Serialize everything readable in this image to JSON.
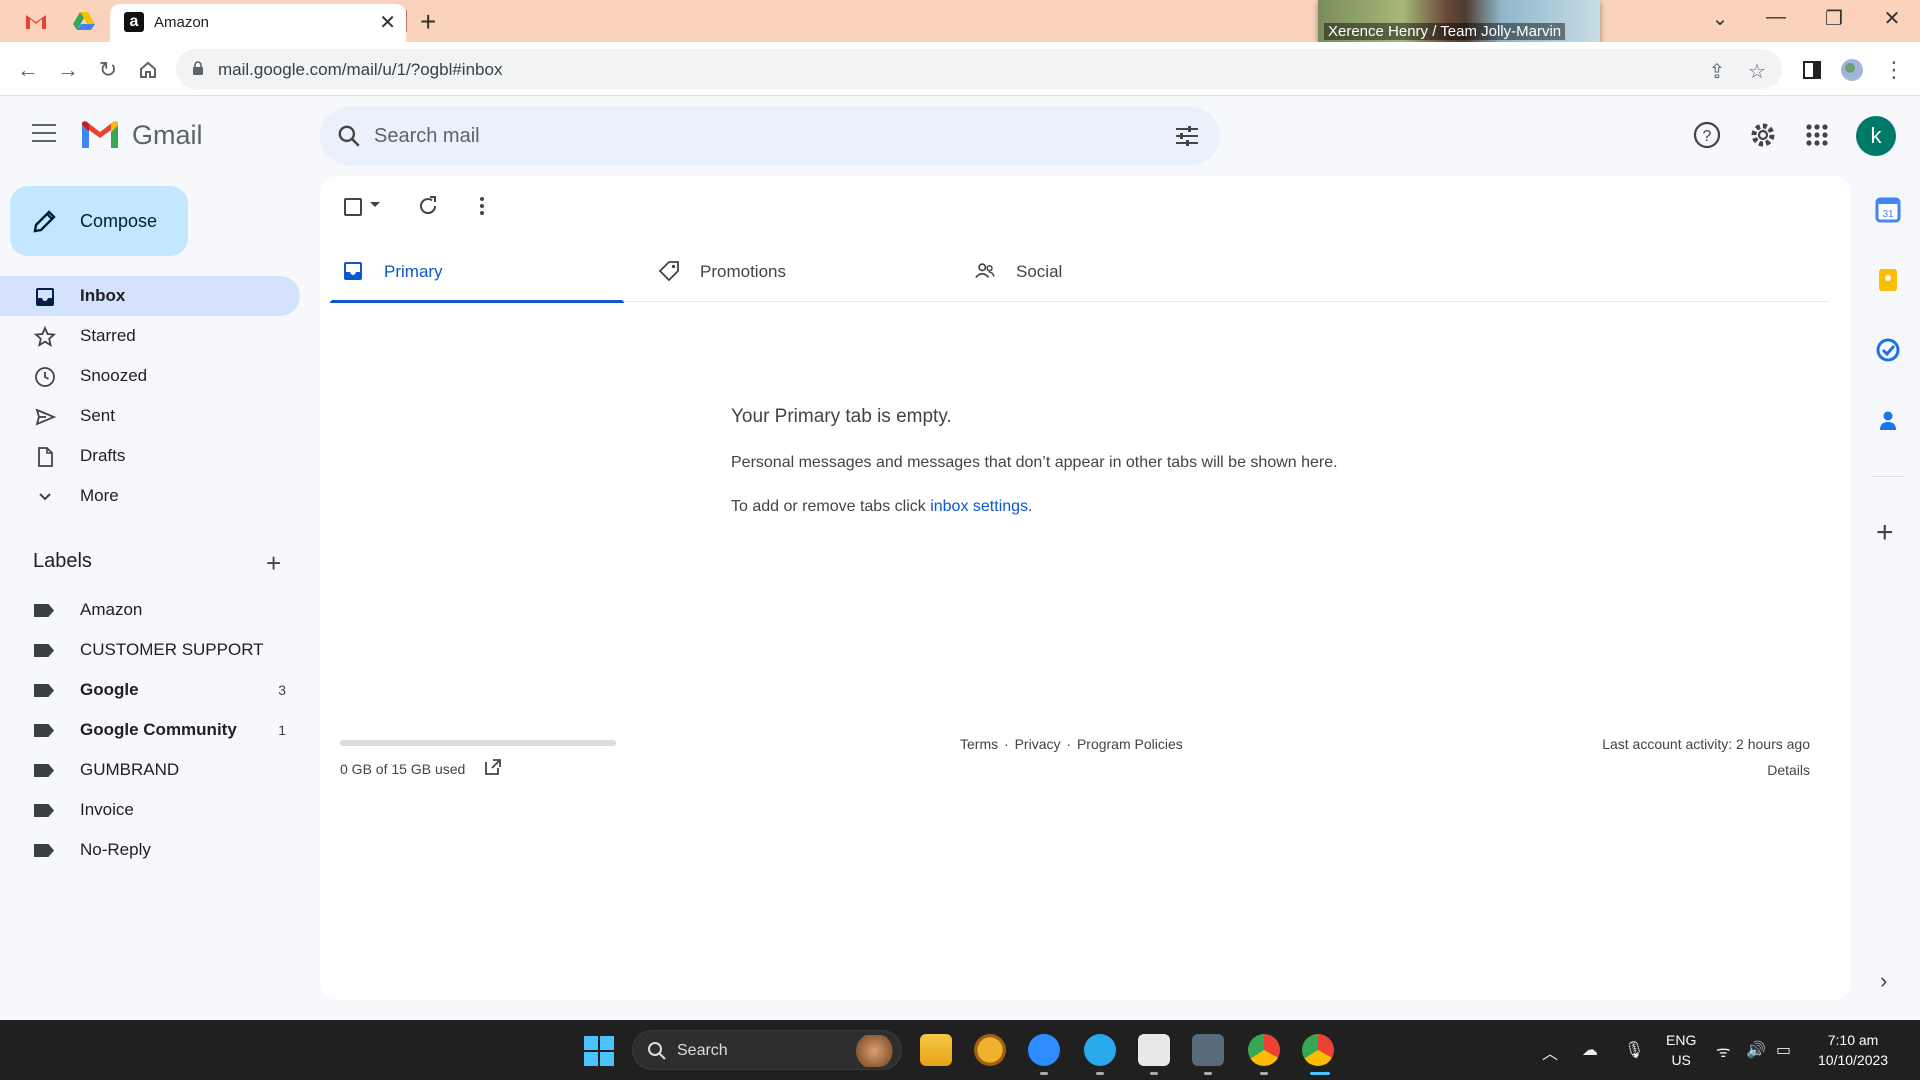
{
  "browser": {
    "tab_title": "Amazon",
    "tab_favicon": "a",
    "url": "mail.google.com/mail/u/1/?ogbl#inbox",
    "video_overlay_name": "Xerence Henry / Team Jolly-Marvin"
  },
  "gmail": {
    "logo_text": "Gmail",
    "search_placeholder": "Search mail",
    "avatar_letter": "k",
    "compose_label": "Compose"
  },
  "nav": [
    {
      "label": "Inbox",
      "icon": "inbox-icon"
    },
    {
      "label": "Starred",
      "icon": "star-icon"
    },
    {
      "label": "Snoozed",
      "icon": "clock-icon"
    },
    {
      "label": "Sent",
      "icon": "send-icon"
    },
    {
      "label": "Drafts",
      "icon": "draft-icon"
    },
    {
      "label": "More",
      "icon": "chevron-down-icon"
    }
  ],
  "labels": {
    "heading": "Labels",
    "items": [
      {
        "label": "Amazon",
        "count": ""
      },
      {
        "label": "CUSTOMER SUPPORT",
        "count": ""
      },
      {
        "label": "Google",
        "count": "3"
      },
      {
        "label": "Google Community",
        "count": "1"
      },
      {
        "label": "GUMBRAND",
        "count": ""
      },
      {
        "label": "Invoice",
        "count": ""
      },
      {
        "label": "No-Reply",
        "count": ""
      }
    ]
  },
  "tabs": [
    {
      "label": "Primary"
    },
    {
      "label": "Promotions"
    },
    {
      "label": "Social"
    }
  ],
  "empty_state": {
    "title": "Your Primary tab is empty.",
    "description": "Personal messages and messages that don’t appear in other tabs will be shown here.",
    "tip_prefix": "To add or remove tabs click ",
    "tip_link": "inbox settings",
    "tip_suffix": "."
  },
  "footer": {
    "storage": "0 GB of 15 GB used",
    "storage_fraction": 0.0,
    "terms": "Terms",
    "privacy": "Privacy",
    "policies": "Program Policies",
    "separator": "·",
    "last_activity": "Last account activity: 2 hours ago",
    "details": "Details"
  },
  "taskbar": {
    "search_label": "Search",
    "lang_top": "ENG",
    "lang_bottom": "US",
    "time": "7:10 am",
    "date": "10/10/2023"
  },
  "colors": {
    "accent": "#0b57d0",
    "compose_bg": "#c2e7ff",
    "active_nav": "#d3e3fd",
    "tab_strip": "#fbd3bd"
  }
}
